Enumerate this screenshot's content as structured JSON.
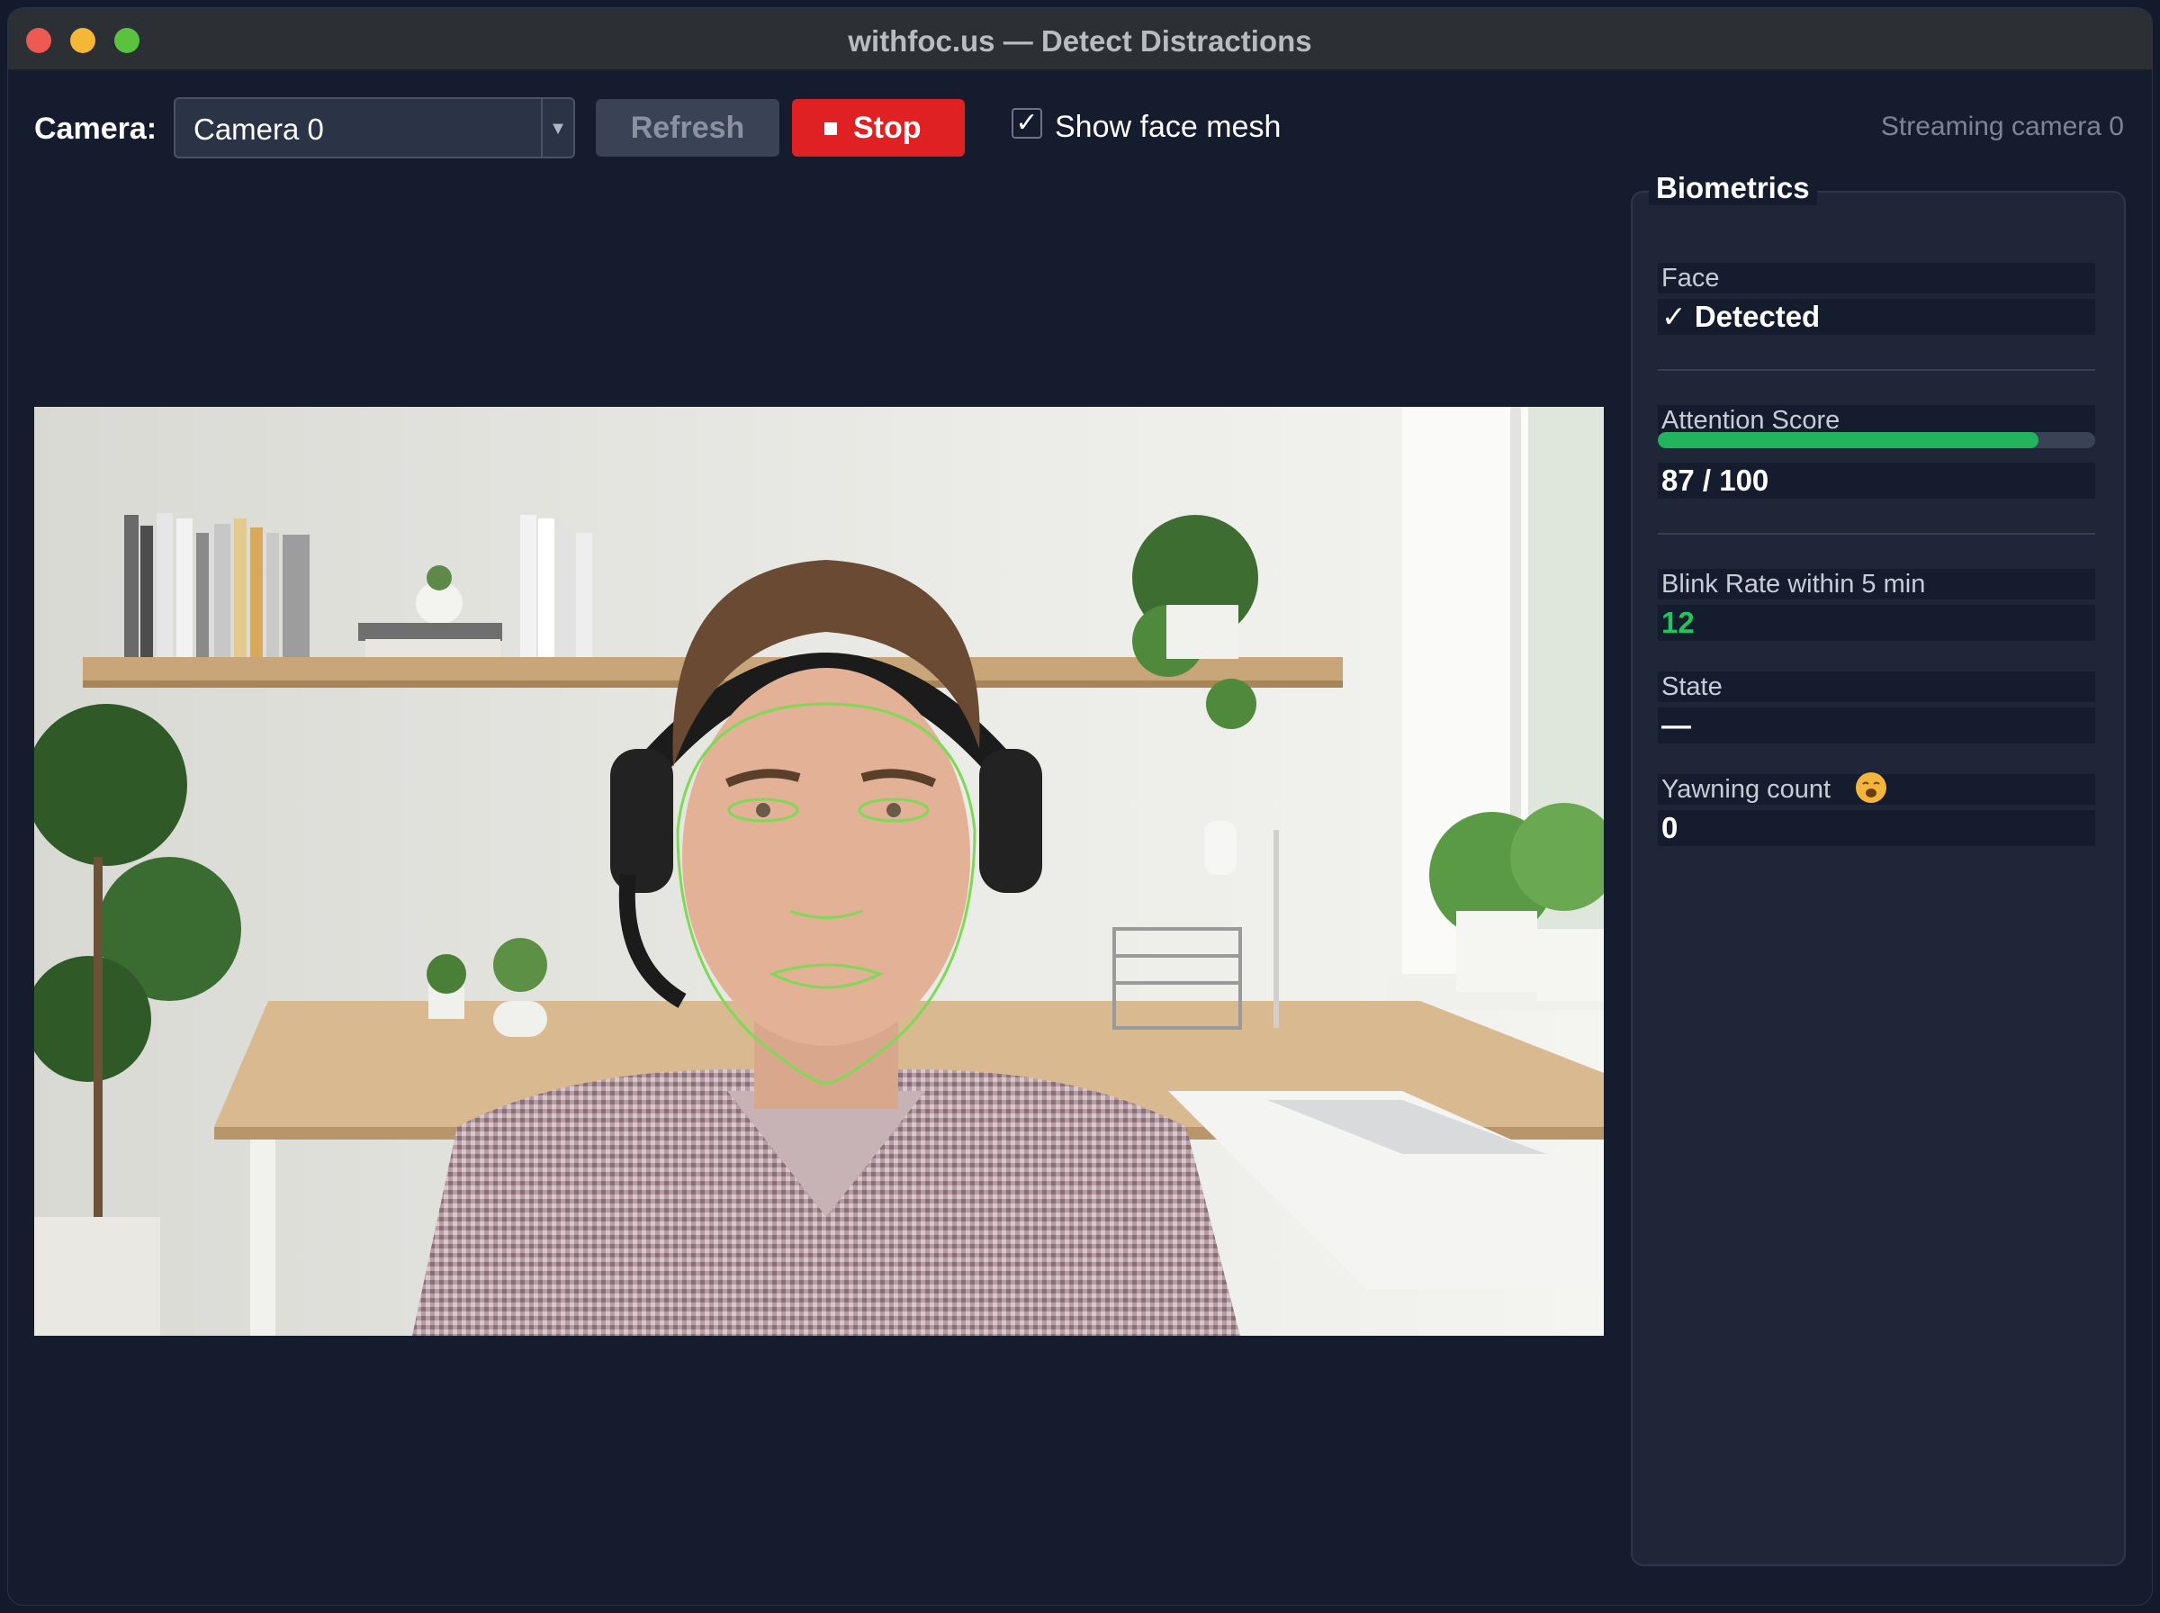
{
  "window": {
    "title": "withfoc.us — Detect Distractions"
  },
  "toolbar": {
    "camera_label": "Camera:",
    "camera_select_value": "Camera 0",
    "refresh_label": "Refresh",
    "stop_label": "Stop",
    "face_mesh_checkbox_checked": true,
    "face_mesh_label": "Show face mesh",
    "status_text": "Streaming camera 0"
  },
  "biometrics": {
    "title": "Biometrics",
    "face": {
      "label": "Face",
      "value": "✓ Detected"
    },
    "attention": {
      "label": "Attention Score",
      "value": "87 / 100",
      "fraction": 0.87
    },
    "blink": {
      "label": "Blink Rate within 5 min",
      "value": "12"
    },
    "state": {
      "label": "State",
      "value": "—"
    },
    "yawning": {
      "label": "Yawning count",
      "value": "0",
      "icon": "yawning-face-icon"
    }
  },
  "colors": {
    "stop_button": "#e02124",
    "attention_bar": "#22b35c",
    "blink_value": "#22c55e",
    "face_mesh": "#7ed957",
    "background": "#141c2e"
  }
}
